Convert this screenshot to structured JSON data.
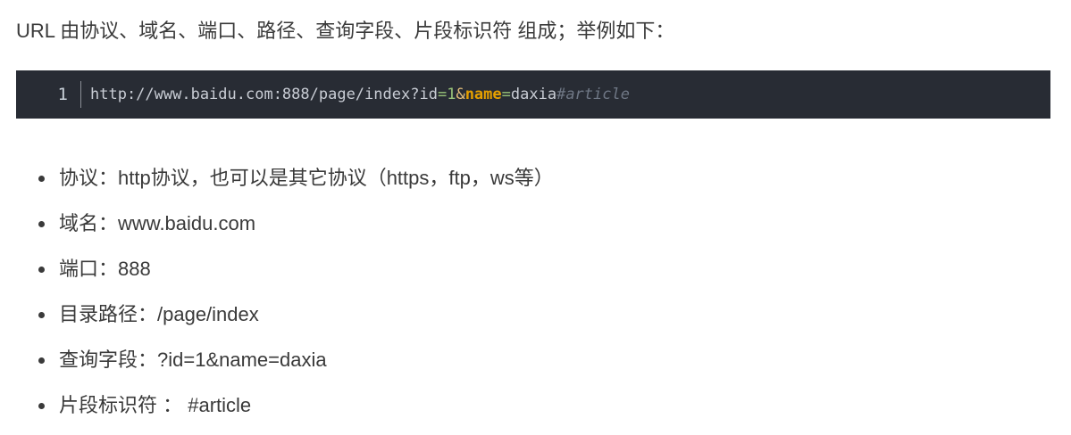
{
  "intro": {
    "text": "URL 由协议、域名、端口、路径、查询字段、片段标识符 组成；举例如下："
  },
  "code": {
    "line_number": "1",
    "tokens": [
      {
        "text": "http://www.baidu.com:888/page/index?id",
        "class": "tok-plain"
      },
      {
        "text": "=",
        "class": "tok-num"
      },
      {
        "text": "1",
        "class": "tok-num"
      },
      {
        "text": "&",
        "class": "tok-amp"
      },
      {
        "text": "name",
        "class": "tok-key"
      },
      {
        "text": "=",
        "class": "tok-num"
      },
      {
        "text": "daxia",
        "class": "tok-plain"
      },
      {
        "text": "#article",
        "class": "tok-comment"
      }
    ]
  },
  "items": [
    {
      "text": "协议：http协议，也可以是其它协议（https，ftp，ws等）"
    },
    {
      "text": "域名：www.baidu.com"
    },
    {
      "text": "端口：888"
    },
    {
      "text": "目录路径：/page/index"
    },
    {
      "text": "查询字段：?id=1&name=daxia"
    },
    {
      "text": "片段标识符 ： #article"
    }
  ],
  "colors": {
    "code_background": "#282c34",
    "text": "#3a3a3a",
    "code_keyword": "#e5a000",
    "code_number": "#98c379",
    "code_comment": "#6f7785"
  }
}
